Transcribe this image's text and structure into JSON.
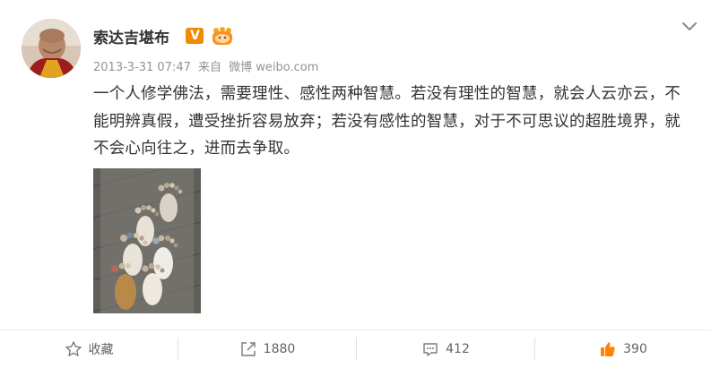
{
  "post": {
    "username": "索达吉堪布",
    "verified_badge": "V",
    "level_badge_icon": "vip-crown-icon",
    "date": "2013-3-31 07:47",
    "source_prefix": "来自",
    "source": "微博 weibo.com",
    "text": "一个人修学佛法，需要理性、感性两种智慧。若没有理性的智慧，就会人云亦云，不能明辨真假，遭受挫折容易放弃；若没有感性的智慧，对于不可思议的超胜境界，就不会心向往之，进而去争取。"
  },
  "actions": {
    "favorite": {
      "label": "收藏",
      "icon": "star-icon"
    },
    "repost": {
      "count": "1880",
      "icon": "share-icon"
    },
    "comment": {
      "count": "412",
      "icon": "comment-icon"
    },
    "like": {
      "count": "390",
      "icon": "thumbs-up-icon"
    }
  },
  "colors": {
    "meta_gray": "#939393",
    "action_gray": "#636363",
    "verified_orange": "#f08a00",
    "like_orange": "#ff8200"
  }
}
